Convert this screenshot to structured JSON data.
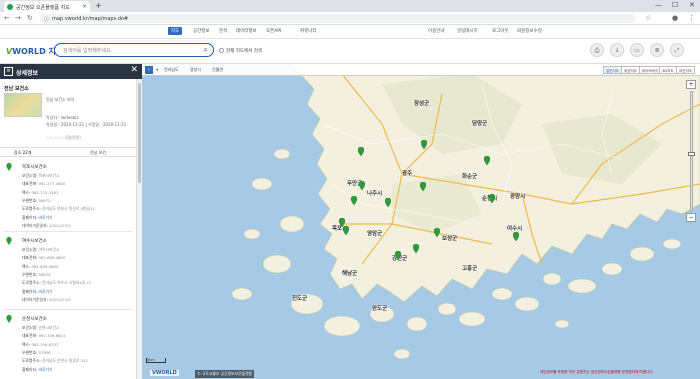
{
  "browser": {
    "tab_title": "공간정보 오픈플랫폼 지도",
    "tab_close": "×",
    "new_tab": "+",
    "url": "map.vworld.kr/map/maps.do#",
    "win_min": "—",
    "win_max": "☐",
    "win_close": "✕",
    "back": "←",
    "forward": "→",
    "reload": "↻"
  },
  "topnav": {
    "items": [
      "지도",
      "공간정보",
      "분석",
      "데이터정보",
      "오픈API",
      "커뮤니티"
    ],
    "active_index": 0,
    "utilities": [
      "이용안내",
      "알림메시지",
      "로그아웃",
      "회원정보수정"
    ]
  },
  "header": {
    "logo_prefix": "V",
    "logo_suffix": "WORLD 지도",
    "search_placeholder": "검색어를 입력해주세요.",
    "checkbox_label": "현재 지도에서 검색"
  },
  "panel": {
    "title": "상세정보",
    "item_title": "전남 보건소",
    "item_desc": "전남 보건소 위치",
    "meta_author": "작성자 : lwdaebiz",
    "meta_dates": "작성일 : 2020-11-21 | 수정일 : 2020-11-21",
    "rating": "☆☆☆☆☆ 0점(0명)",
    "tab_a": "장소 22개",
    "tab_b": "전남 보건",
    "entries": [
      {
        "name": "목포시보건소",
        "rows": [
          {
            "k": "보건소명:",
            "v": "목포시보건소"
          },
          {
            "k": "대표전화:",
            "v": "061-277-4600"
          },
          {
            "k": "팩스:",
            "v": "061-270-3181"
          },
          {
            "k": "우편번호:",
            "v": "58672"
          },
          {
            "k": "도로명주소:",
            "v": "전라남도 목포시 원산로 4번길11"
          },
          {
            "k": "홈페이지:",
            "v": "바로가기",
            "link": true
          },
          {
            "k": "데이터기준일자:",
            "v": "2020-07-01"
          }
        ]
      },
      {
        "name": "여수시보건소",
        "rows": [
          {
            "k": "보건소명:",
            "v": "여수시보건소"
          },
          {
            "k": "대표전화:",
            "v": "061-690-4600"
          },
          {
            "k": "팩스:",
            "v": "061-659-5609"
          },
          {
            "k": "우편번호:",
            "v": "59674"
          },
          {
            "k": "도로명주소:",
            "v": "전라남도 여수시 시청서4길 47"
          },
          {
            "k": "홈페이지:",
            "v": "바로가기",
            "link": true
          },
          {
            "k": "데이터기준일자:",
            "v": "2020-07-01"
          }
        ]
      },
      {
        "name": "순천시보건소",
        "rows": [
          {
            "k": "보건소명:",
            "v": "순천시보건소"
          },
          {
            "k": "대표전화:",
            "v": "061-749-6614"
          },
          {
            "k": "팩스:",
            "v": "061-749-6707"
          },
          {
            "k": "우편번호:",
            "v": "57956"
          },
          {
            "k": "도로명주소:",
            "v": "전라남도 순천시 중앙로 232"
          },
          {
            "k": "홈페이지:",
            "v": "바로가기",
            "link": true
          }
        ]
      }
    ]
  },
  "map": {
    "breadcrumb": [
      "전라남도",
      "광양시",
      "진월면"
    ],
    "map_types": [
      "일반지도",
      "위성지도",
      "하이브리드",
      "3D지도",
      "야간지도"
    ],
    "active_map_type": 0,
    "zoom_in": "+",
    "zoom_out": "−",
    "cities": [
      "장성군",
      "담양군",
      "광주",
      "화순군",
      "나주시",
      "영암군",
      "목포시",
      "무안군",
      "강진군",
      "보성군",
      "순천시",
      "광양시",
      "여수시",
      "고흥군",
      "해남군",
      "완도군",
      "진도군"
    ],
    "footer_logo": "VWORLD",
    "footer_copy": "© 국토교통부 공간정보오픈플랫폼",
    "notice": "개인정보를 포함한 모든 콘텐츠는 공간정보오픈플랫폼 운영원칙에 따릅니다.",
    "scale": "5km"
  },
  "colors": {
    "accent": "#2f6eb9",
    "panel_header": "#2a3544",
    "sea": "#a6c9e6",
    "land": "#f4f0e0",
    "pin": "#2e9a3a"
  }
}
